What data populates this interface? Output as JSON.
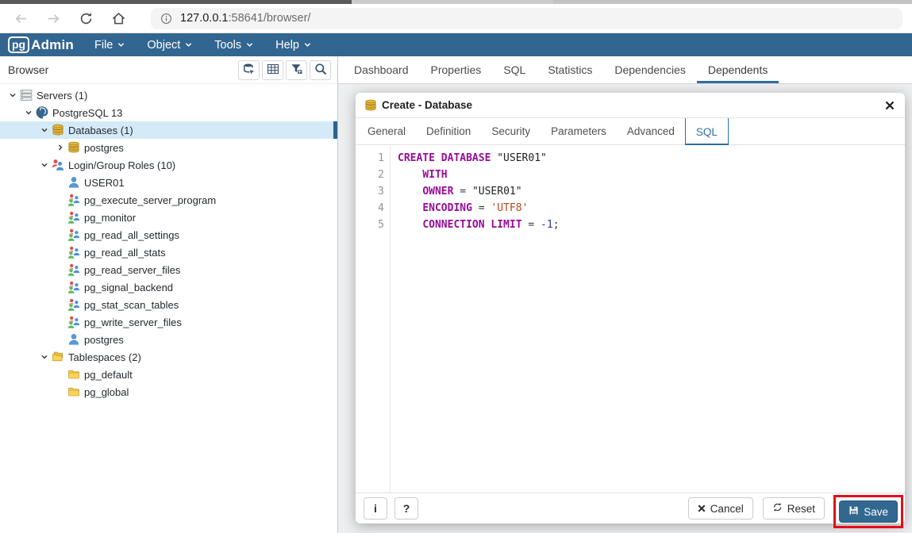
{
  "browser_chrome": {
    "url_host": "127.0.0.1",
    "url_rest": ":58641/browser/"
  },
  "app_header": {
    "logo_pg": "pg",
    "logo_admin": "Admin",
    "menus": [
      {
        "label": "File"
      },
      {
        "label": "Object"
      },
      {
        "label": "Tools"
      },
      {
        "label": "Help"
      }
    ]
  },
  "sidebar": {
    "title": "Browser",
    "tools": [
      {
        "icon": "object-explorer-icon"
      },
      {
        "icon": "grid-icon"
      },
      {
        "icon": "filter-icon"
      },
      {
        "icon": "search-icon"
      }
    ],
    "tree": [
      {
        "label": "Servers (1)",
        "level": 0,
        "expander": "down",
        "icon": "server-icon",
        "selected": false
      },
      {
        "label": "PostgreSQL 13",
        "level": 1,
        "expander": "down",
        "icon": "postgresql-icon",
        "selected": false
      },
      {
        "label": "Databases (1)",
        "level": 2,
        "expander": "down",
        "icon": "database-icon",
        "selected": true
      },
      {
        "label": "postgres",
        "level": 3,
        "expander": "right",
        "icon": "database-icon",
        "selected": false
      },
      {
        "label": "Login/Group Roles (10)",
        "level": 2,
        "expander": "down",
        "icon": "group-roles-icon",
        "selected": false
      },
      {
        "label": "USER01",
        "level": 3,
        "expander": "none",
        "icon": "user-icon",
        "selected": false
      },
      {
        "label": "pg_execute_server_program",
        "level": 3,
        "expander": "none",
        "icon": "role-group-icon",
        "selected": false
      },
      {
        "label": "pg_monitor",
        "level": 3,
        "expander": "none",
        "icon": "role-group-icon",
        "selected": false
      },
      {
        "label": "pg_read_all_settings",
        "level": 3,
        "expander": "none",
        "icon": "role-group-icon",
        "selected": false
      },
      {
        "label": "pg_read_all_stats",
        "level": 3,
        "expander": "none",
        "icon": "role-group-icon",
        "selected": false
      },
      {
        "label": "pg_read_server_files",
        "level": 3,
        "expander": "none",
        "icon": "role-group-icon",
        "selected": false
      },
      {
        "label": "pg_signal_backend",
        "level": 3,
        "expander": "none",
        "icon": "role-group-icon",
        "selected": false
      },
      {
        "label": "pg_stat_scan_tables",
        "level": 3,
        "expander": "none",
        "icon": "role-group-icon",
        "selected": false
      },
      {
        "label": "pg_write_server_files",
        "level": 3,
        "expander": "none",
        "icon": "role-group-icon",
        "selected": false
      },
      {
        "label": "postgres",
        "level": 3,
        "expander": "none",
        "icon": "user-icon",
        "selected": false
      },
      {
        "label": "Tablespaces (2)",
        "level": 2,
        "expander": "down",
        "icon": "tablespaces-icon",
        "selected": false
      },
      {
        "label": "pg_default",
        "level": 3,
        "expander": "none",
        "icon": "folder-icon",
        "selected": false
      },
      {
        "label": "pg_global",
        "level": 3,
        "expander": "none",
        "icon": "folder-icon",
        "selected": false
      }
    ]
  },
  "main_tabs": {
    "items": [
      {
        "label": "Dashboard",
        "active": false
      },
      {
        "label": "Properties",
        "active": false
      },
      {
        "label": "SQL",
        "active": false
      },
      {
        "label": "Statistics",
        "active": false
      },
      {
        "label": "Dependencies",
        "active": false
      },
      {
        "label": "Dependents",
        "active": true
      }
    ]
  },
  "dialog": {
    "title": "Create - Database",
    "tabs": {
      "items": [
        {
          "label": "General",
          "active": false
        },
        {
          "label": "Definition",
          "active": false
        },
        {
          "label": "Security",
          "active": false
        },
        {
          "label": "Parameters",
          "active": false
        },
        {
          "label": "Advanced",
          "active": false
        },
        {
          "label": "SQL",
          "active": true
        }
      ]
    },
    "sql_editor": {
      "lines": [
        {
          "n": "1",
          "segs": [
            {
              "c": "kw",
              "t": "CREATE DATABASE"
            },
            {
              "c": "pl",
              "t": " "
            },
            {
              "c": "id",
              "t": "\"USER01\""
            }
          ]
        },
        {
          "n": "2",
          "segs": [
            {
              "c": "pl",
              "t": "    "
            },
            {
              "c": "kw",
              "t": "WITH"
            }
          ]
        },
        {
          "n": "3",
          "segs": [
            {
              "c": "pl",
              "t": "    "
            },
            {
              "c": "kw",
              "t": "OWNER"
            },
            {
              "c": "pl",
              "t": " = "
            },
            {
              "c": "id",
              "t": "\"USER01\""
            }
          ]
        },
        {
          "n": "4",
          "segs": [
            {
              "c": "pl",
              "t": "    "
            },
            {
              "c": "kw",
              "t": "ENCODING"
            },
            {
              "c": "pl",
              "t": " = "
            },
            {
              "c": "str",
              "t": "'UTF8'"
            }
          ]
        },
        {
          "n": "5",
          "segs": [
            {
              "c": "pl",
              "t": "    "
            },
            {
              "c": "kw",
              "t": "CONNECTION LIMIT"
            },
            {
              "c": "pl",
              "t": " = "
            },
            {
              "c": "num",
              "t": "-1"
            },
            {
              "c": "pl",
              "t": ";"
            }
          ]
        }
      ]
    },
    "footer": {
      "info_label": "i",
      "help_label": "?",
      "cancel_label": "Cancel",
      "reset_label": "Reset",
      "save_label": "Save"
    }
  },
  "colors": {
    "header_blue": "#326690",
    "active_tab_blue": "#2e6da4",
    "selected_row": "#d4eaf8",
    "save_button": "#326790",
    "annotation_red": "#e60c19",
    "sql_keyword": "#980c98",
    "sql_string": "#b4451f",
    "sql_number": "#2936a6"
  }
}
